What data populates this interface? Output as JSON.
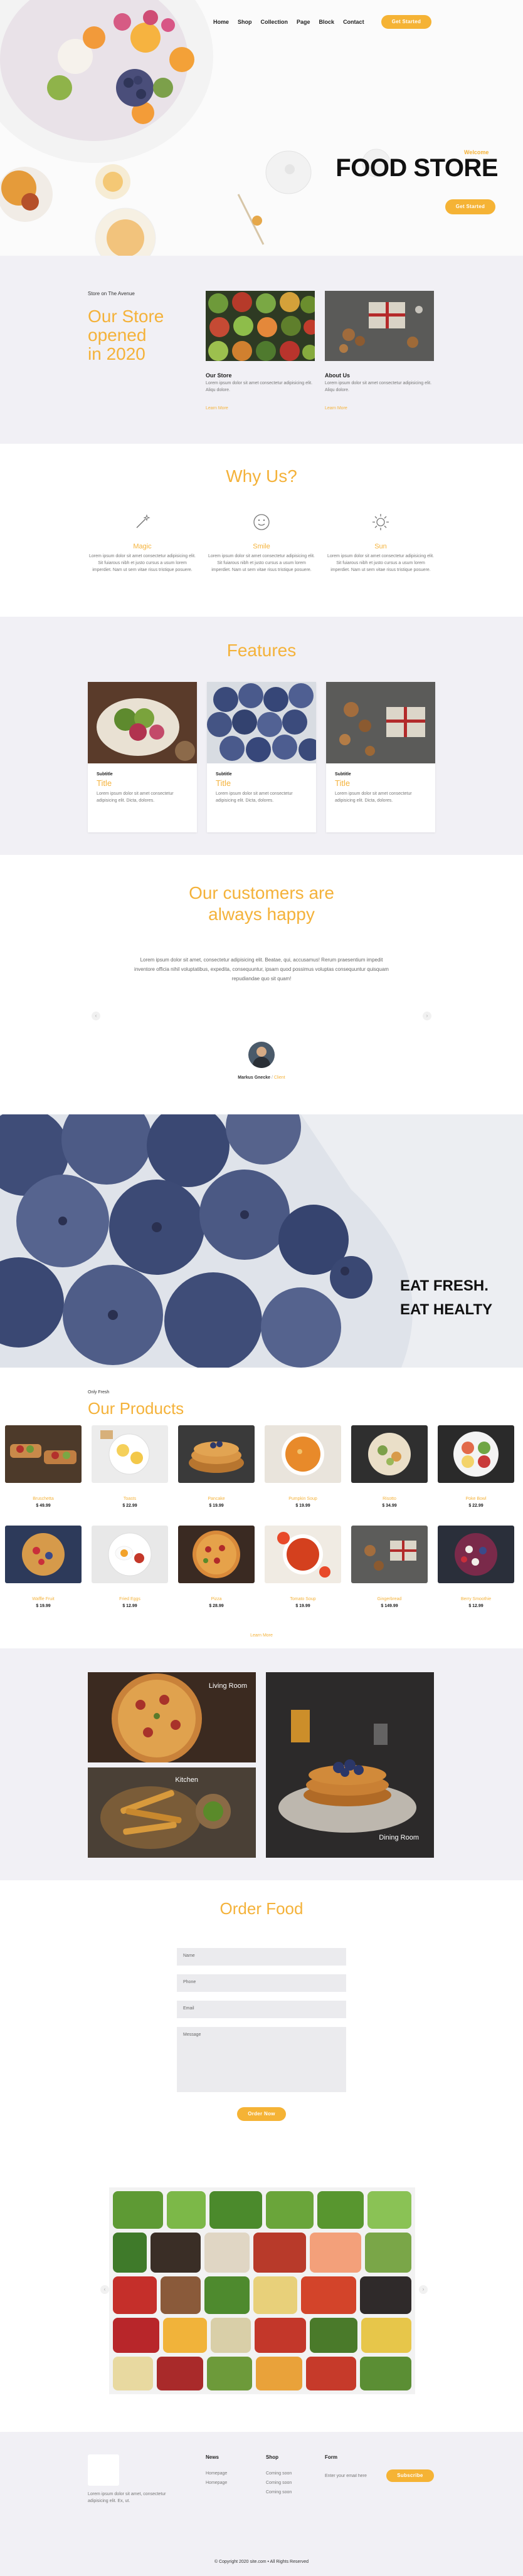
{
  "nav": {
    "items": [
      "Home",
      "Shop",
      "Collection",
      "Page",
      "Block",
      "Contact"
    ],
    "cta": "Get Started"
  },
  "hero": {
    "kicker": "Welcome",
    "title": "FOOD STORE",
    "cta": "Get Started"
  },
  "about": {
    "kicker": "Store on The Avenue",
    "title_lines": [
      "Our Store",
      "opened",
      "in 2020"
    ],
    "cards": [
      {
        "title": "Our Store",
        "text": "Lorem ipsum dolor sit amet consectetur adipisicing elit. Aliqu dolore.",
        "link": "Learn More"
      },
      {
        "title": "About Us",
        "text": "Lorem ipsum dolor sit amet consectetur adipisicing elit. Aliqu dolore.",
        "link": "Learn More"
      }
    ]
  },
  "why": {
    "title": "Why Us?",
    "items": [
      {
        "icon": "magic-wand-icon",
        "title": "Magic",
        "text": "Lorem ipsum dolor sit amet consectetur adipisicing elit. Sit fuiarous nibh et justo cursus a usum lorem imperdiet. Nam ut sem vitae risus tristique posuere."
      },
      {
        "icon": "smiley-icon",
        "title": "Smile",
        "text": "Lorem ipsum dolor sit amet consectetur adipisicing elit. Sit fuiarous nibh et justo cursus a usum lorem imperdiet. Nam ut sem vitae risus tristique posuere."
      },
      {
        "icon": "sun-icon",
        "title": "Sun",
        "text": "Lorem ipsum dolor sit amet consectetur adipisicing elit. Sit fuiarous nibh et justo cursus a usum lorem imperdiet. Nam ut sem vitae risus tristique posuere."
      }
    ]
  },
  "features": {
    "title": "Features",
    "cards": [
      {
        "subtitle": "Subtitle",
        "title": "Title",
        "text": "Lorem ipsum dolor sit amet consectetur adipisicing elit. Dicta, dolores."
      },
      {
        "subtitle": "Subtitle",
        "title": "Title",
        "text": "Lorem ipsum dolor sit amet consectetur adipisicing elit. Dicta, dolores."
      },
      {
        "subtitle": "Subtitle",
        "title": "Title",
        "text": "Lorem ipsum dolor sit amet consectetur adipisicing elit. Dicta, dolores."
      }
    ]
  },
  "testimonial": {
    "title_lines": [
      "Our customers are",
      "always happy"
    ],
    "quote": "Lorem ipsum dolor sit amet, consectetur adipisicing elit. Beatae, qui, accusamus! Rerum praesentium impedit inventore officia nihil voluptatibus, expedita, consequuntur, ipsam quod possimus voluptas consequuntur quisquam repudiandae quo sit quam!",
    "name": "Markus Gnecke",
    "role": "Client"
  },
  "banner": {
    "line1": "EAT FRESH.",
    "line2": "EAT HEALTY"
  },
  "products": {
    "kicker": "Only Fresh",
    "title": "Our Products",
    "items": [
      {
        "name": "Bruschetta",
        "price": "$ 49.99"
      },
      {
        "name": "Toasts",
        "price": "$ 22.99"
      },
      {
        "name": "Pancake",
        "price": "$ 19.99"
      },
      {
        "name": "Pumpkin Soup",
        "price": "$ 19.99"
      },
      {
        "name": "Risotto",
        "price": "$ 34.99"
      },
      {
        "name": "Poke Bowl",
        "price": "$ 22.99"
      },
      {
        "name": "Waffle Fruit",
        "price": "$ 19.99"
      },
      {
        "name": "Fried Eggs",
        "price": "$ 12.99"
      },
      {
        "name": "Pizza",
        "price": "$ 28.99"
      },
      {
        "name": "Tomato Soup",
        "price": "$ 19.99"
      },
      {
        "name": "Gingerbread",
        "price": "$ 149.99"
      },
      {
        "name": "Berry Smoothie",
        "price": "$ 12.99"
      }
    ],
    "more": "Learn More"
  },
  "gallery": {
    "labels": [
      "Living Room",
      "Dining Room",
      "Kitchen",
      "Dining Room"
    ]
  },
  "order": {
    "title": "Order Food",
    "fields": [
      "Name",
      "Phone",
      "Email",
      "Message"
    ],
    "submit": "Order Now"
  },
  "footer": {
    "about": "Lorem ipsum dolor sit amet, consectetur adipisicing elit. Ex, ut.",
    "cols": [
      {
        "title": "News",
        "links": [
          "Homepage",
          "Homepage"
        ]
      },
      {
        "title": "Shop",
        "links": [
          "Coming soon",
          "Coming soon",
          "Coming soon"
        ]
      }
    ],
    "form_title": "Form",
    "email_placeholder": "Enter your email here",
    "subscribe": "Subscribe",
    "copyright": "© Copyright 2020 site.com • All Rights Reserved"
  },
  "colors": {
    "accent": "#f4b23a",
    "section_bg": "#f1f0f5",
    "dark": "#222222"
  }
}
